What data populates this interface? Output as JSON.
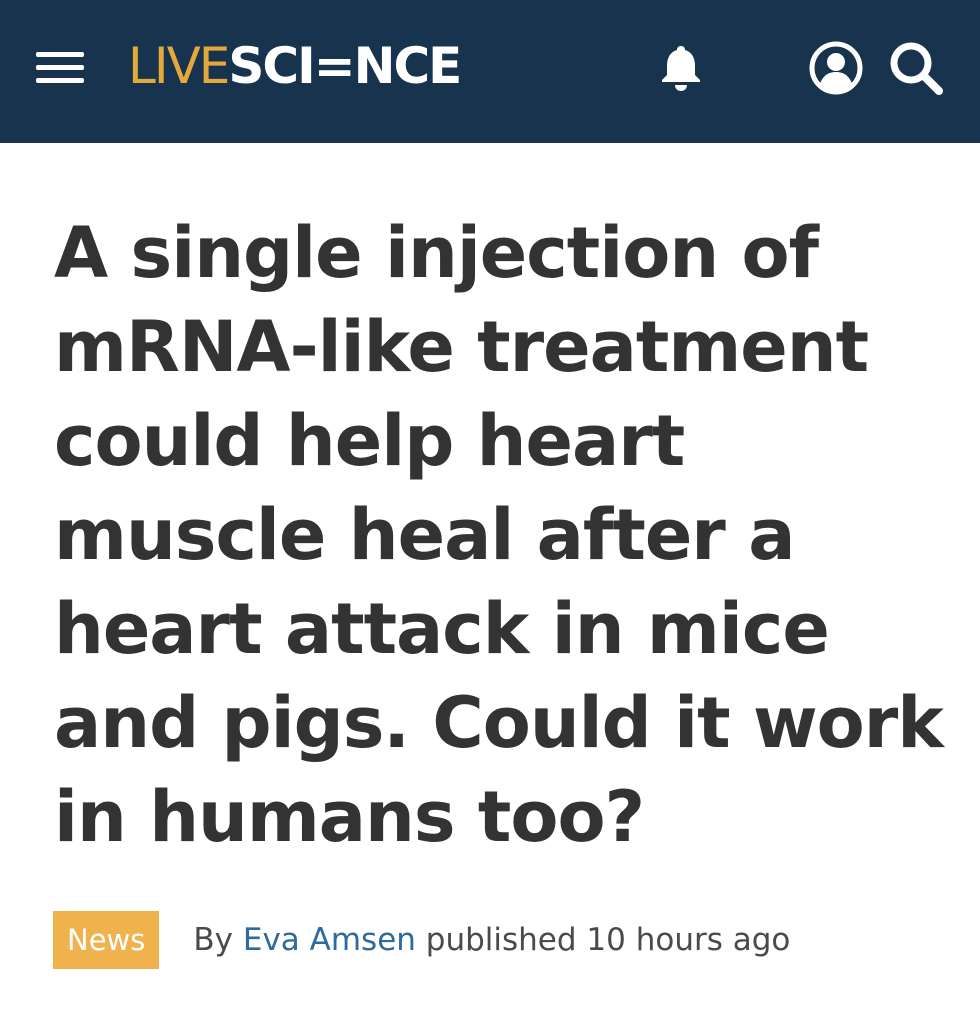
{
  "header": {
    "logo_live": "LIVE",
    "logo_science": "SCI=NCE",
    "icons": [
      "menu-icon",
      "bell-icon",
      "user-icon",
      "search-icon"
    ]
  },
  "article": {
    "headline": "A single injection of mRNA-like treatment could help heart muscle heal after a heart attack in mice and pigs. Could it work in humans too?",
    "category": "News",
    "by_label": "By",
    "author": "Eva Amsen",
    "published": "published 10 hours ago"
  },
  "colors": {
    "header_bg": "#17334d",
    "logo_live": "#e3a93b",
    "badge_bg": "#f0b24d",
    "author_link": "#2d6a9e",
    "headline_text": "#333333"
  }
}
